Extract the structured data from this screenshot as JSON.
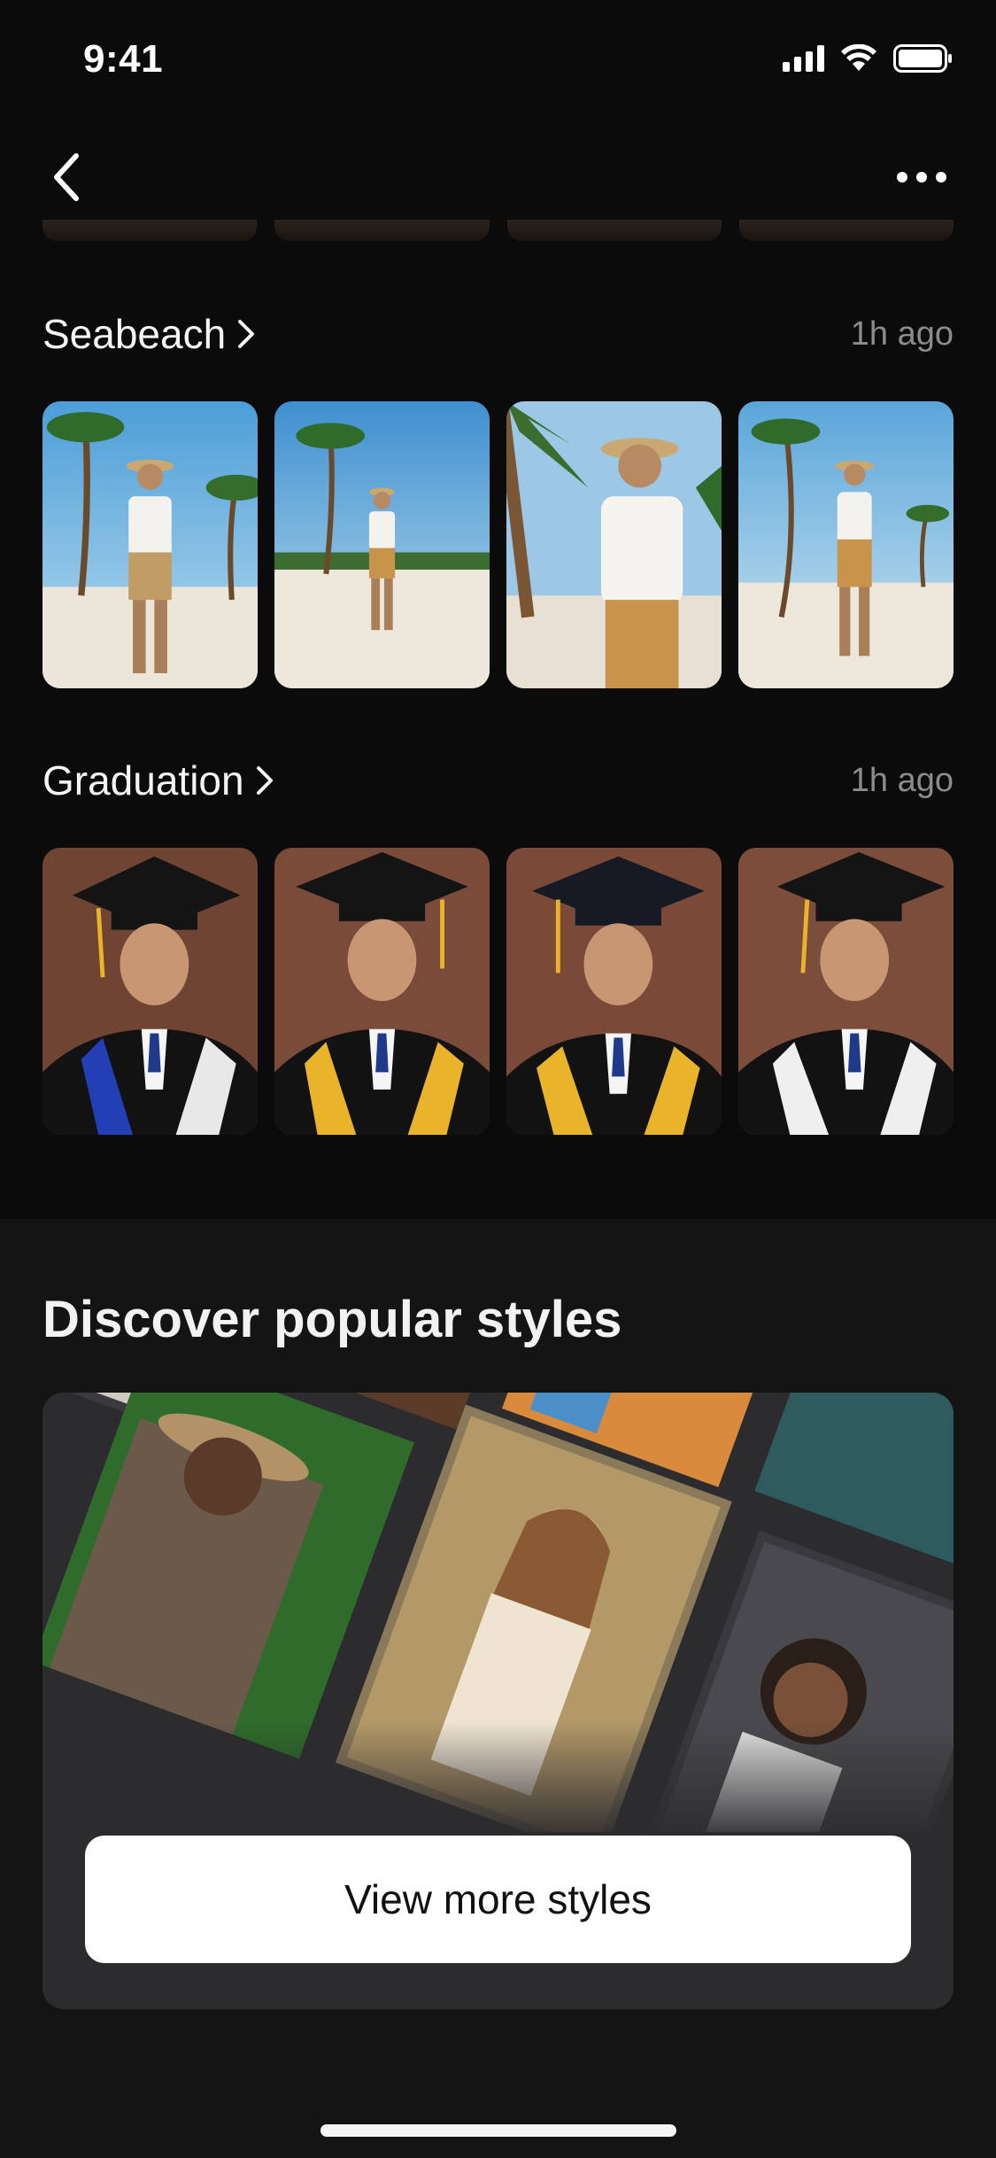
{
  "status_bar": {
    "time": "9:41"
  },
  "nav": {
    "back_icon": "chevron-left-icon",
    "more_icon": "ellipsis-icon"
  },
  "sections": [
    {
      "title": "Seabeach",
      "time": "1h ago",
      "photos": [
        "beach-portrait-1",
        "beach-portrait-2",
        "beach-portrait-3",
        "beach-portrait-4"
      ]
    },
    {
      "title": "Graduation",
      "time": "1h ago",
      "photos": [
        "graduation-portrait-1",
        "graduation-portrait-2",
        "graduation-portrait-3",
        "graduation-portrait-4"
      ]
    }
  ],
  "discover": {
    "title": "Discover popular styles",
    "button_label": "View more styles"
  },
  "colors": {
    "background": "#0b0b0c",
    "card": "#2c2c2f",
    "secondary_text": "#8c8c8f",
    "button": "#ffffff"
  }
}
